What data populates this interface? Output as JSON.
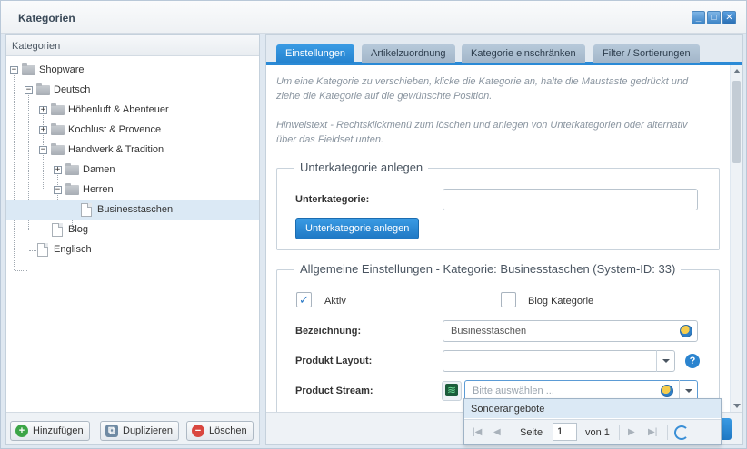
{
  "window": {
    "title": "Kategorien",
    "buttons": {
      "minimize": "_",
      "maximize": "□",
      "close": "✕"
    }
  },
  "tree_panel": {
    "header": "Kategorien",
    "nodes": [
      {
        "label": "Shopware",
        "expander": "−"
      },
      {
        "label": "Deutsch",
        "expander": "−"
      },
      {
        "label": "Höhenluft & Abenteuer",
        "expander": "+"
      },
      {
        "label": "Kochlust & Provence",
        "expander": "+"
      },
      {
        "label": "Handwerk & Tradition",
        "expander": "−"
      },
      {
        "label": "Damen",
        "expander": "+"
      },
      {
        "label": "Herren",
        "expander": "−"
      },
      {
        "label": "Businesstaschen",
        "selected": true
      },
      {
        "label": "Blog"
      },
      {
        "label": "Englisch"
      }
    ],
    "footer": {
      "add": "Hinzufügen",
      "duplicate": "Duplizieren",
      "delete": "Löschen"
    }
  },
  "tabs": [
    {
      "label": "Einstellungen",
      "active": true
    },
    {
      "label": "Artikelzuordnung"
    },
    {
      "label": "Kategorie einschränken"
    },
    {
      "label": "Filter / Sortierungen"
    }
  ],
  "hints": {
    "move": "Um eine Kategorie zu verschieben, klicke die Kategorie an, halte die Maustaste gedrückt und ziehe die Kategorie auf die gewünschte Position.",
    "context": "Hinweistext - Rechtsklickmenü zum löschen und anlegen von Unterkategorien oder alternativ über das Fieldset unten."
  },
  "subcategory": {
    "legend": "Unterkategorie anlegen",
    "label": "Unterkategorie:",
    "value": "",
    "button": "Unterkategorie anlegen"
  },
  "general": {
    "legend": "Allgemeine Einstellungen - Kategorie: Businesstaschen (System-ID: 33)",
    "active_label": "Aktiv",
    "active_checked": true,
    "blog_label": "Blog Kategorie",
    "blog_checked": false,
    "name_label": "Bezeichnung:",
    "name_value": "Businesstaschen",
    "layout_label": "Produkt Layout:",
    "layout_value": "",
    "stream_label": "Product Stream:",
    "stream_placeholder": "Bitte auswählen ..."
  },
  "dropdown": {
    "option": "Sonderangebote",
    "page_label": "Seite",
    "page_value": "1",
    "of_label": "von 1"
  }
}
